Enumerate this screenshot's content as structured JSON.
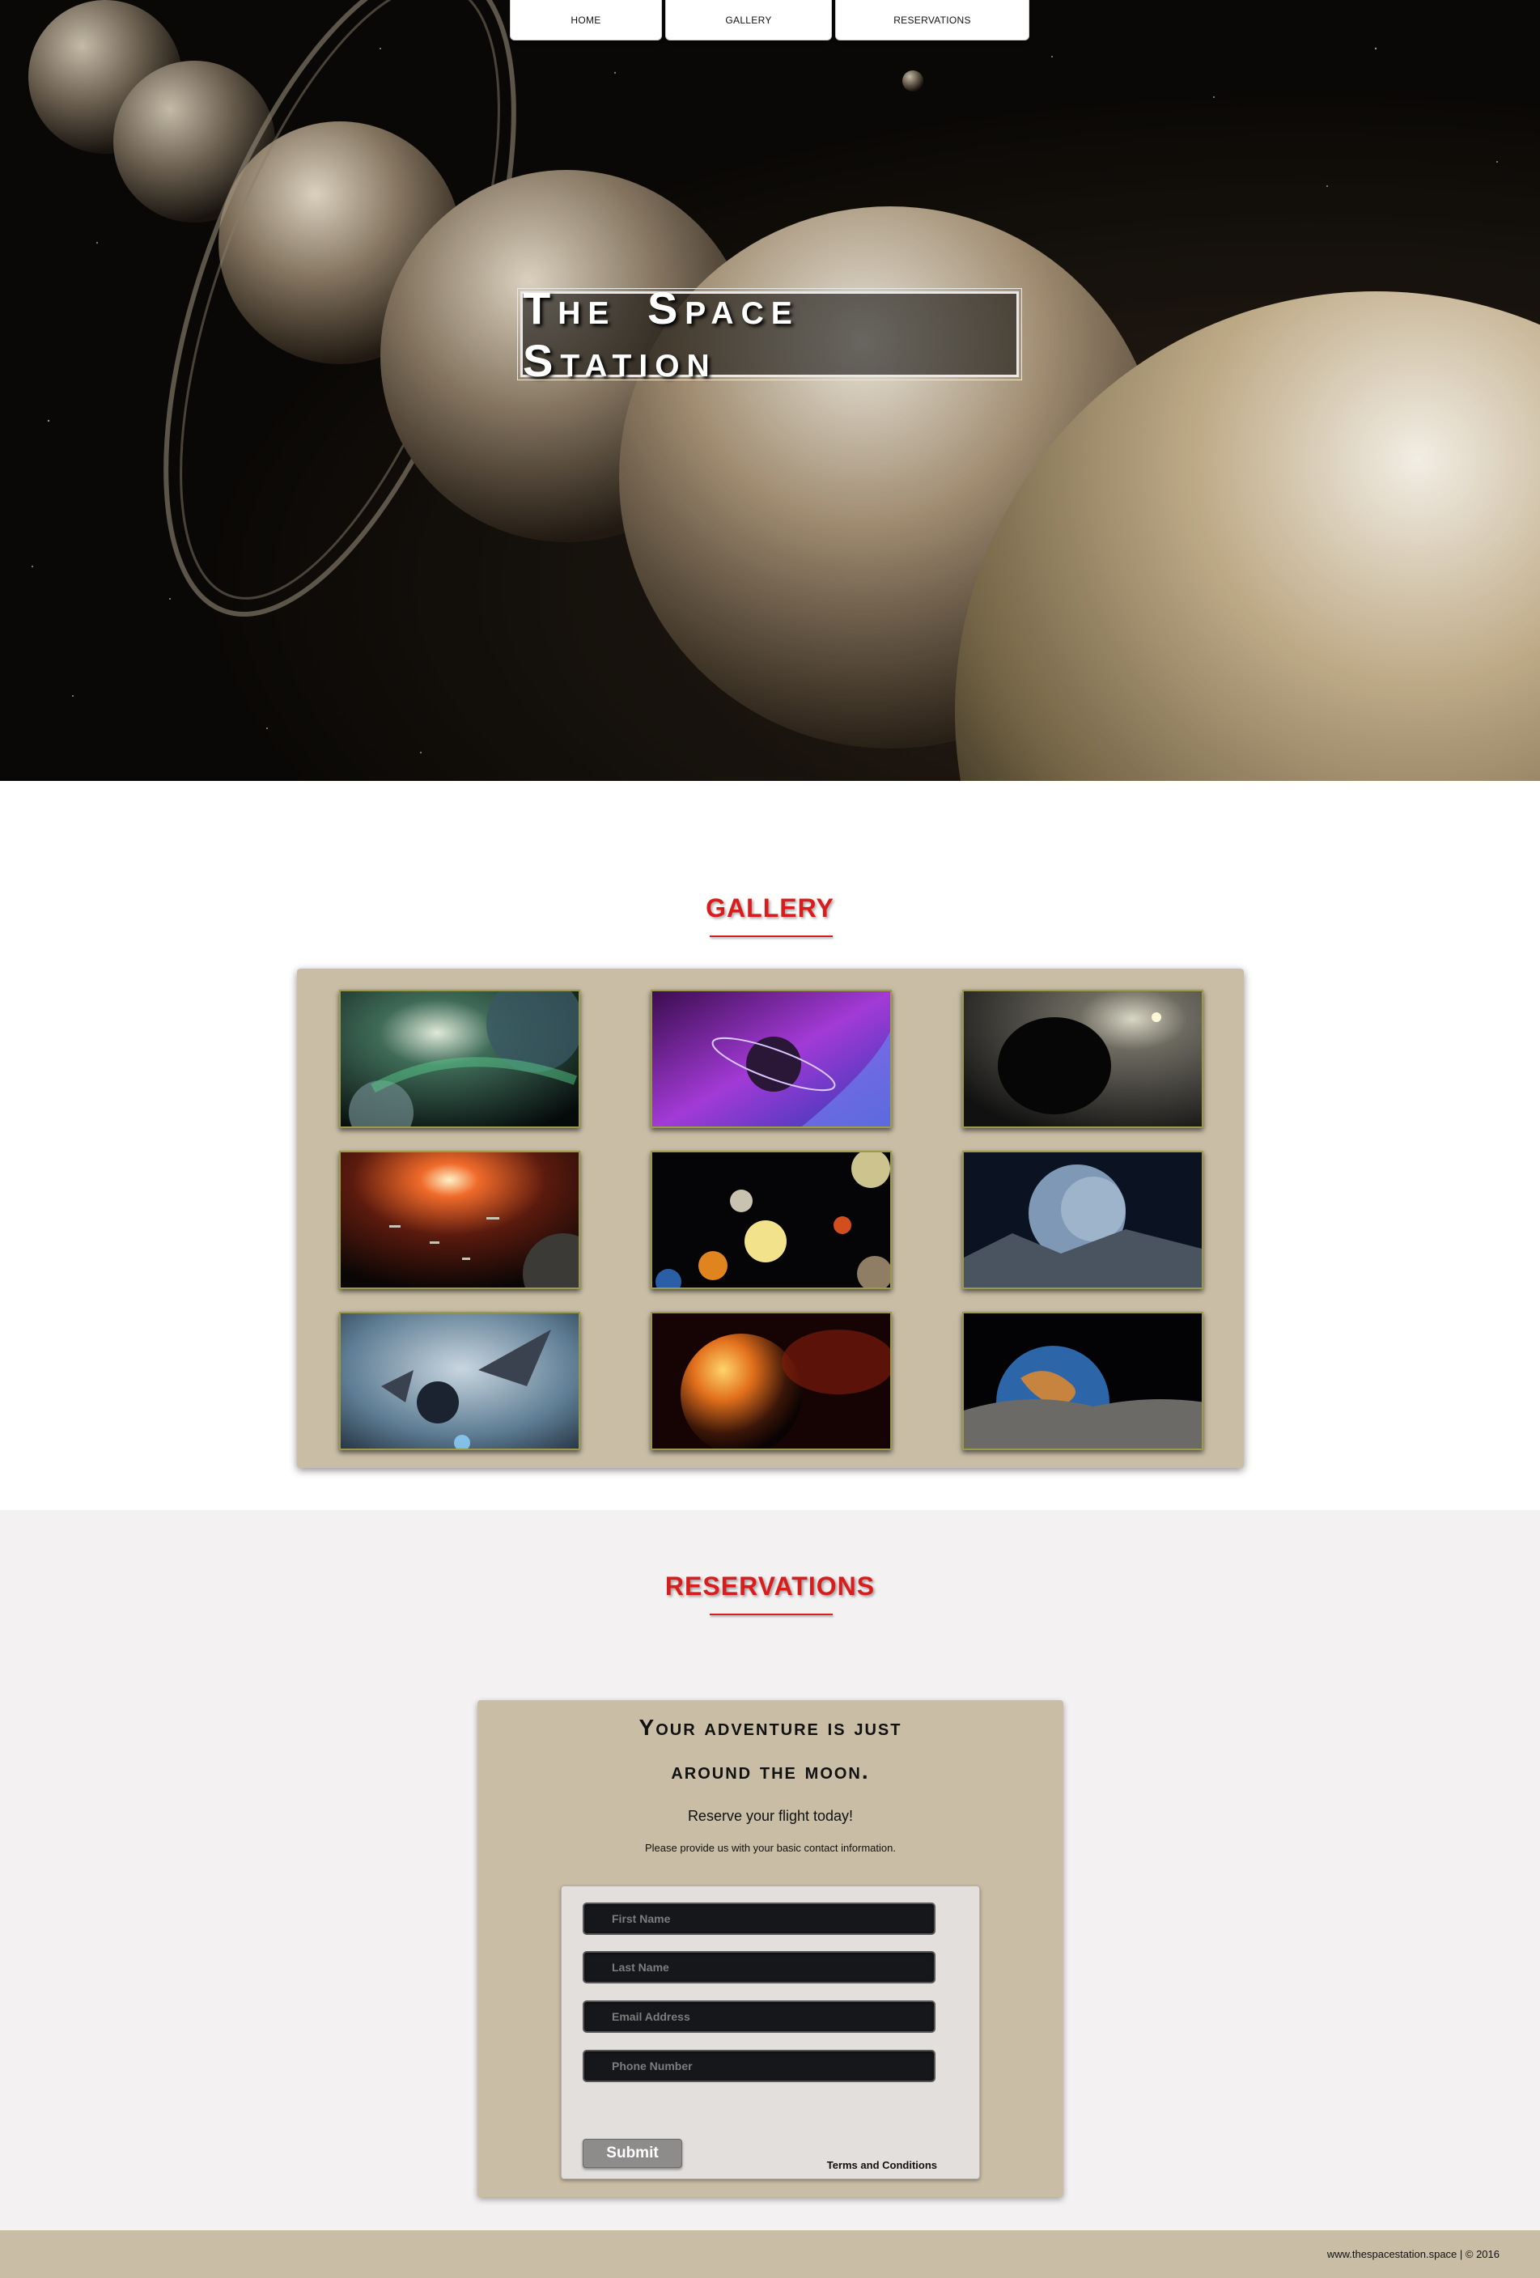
{
  "nav": {
    "items": [
      {
        "label": "HOME"
      },
      {
        "label": "GALLERY"
      },
      {
        "label": "RESERVATIONS"
      }
    ]
  },
  "hero": {
    "title": "The Space Station",
    "image_icon": "planets-image"
  },
  "gallery": {
    "title": "GALLERY",
    "thumbnails": [
      {
        "icon": "space-nebula-planet-image"
      },
      {
        "icon": "purple-ringed-planet-image"
      },
      {
        "icon": "black-hole-image"
      },
      {
        "icon": "space-battle-fleet-image"
      },
      {
        "icon": "solar-system-planets-image"
      },
      {
        "icon": "moon-surface-planet-image"
      },
      {
        "icon": "starships-blue-planet-image"
      },
      {
        "icon": "fiery-planet-image"
      },
      {
        "icon": "earth-from-moon-image"
      }
    ]
  },
  "reservations": {
    "title": "RESERVATIONS",
    "headline_line1": "Your adventure is just",
    "headline_line2": "around the moon.",
    "subhead": "Reserve your flight today!",
    "note": "Please provide us with your basic contact information.",
    "fields": [
      {
        "placeholder": "First Name"
      },
      {
        "placeholder": "Last Name"
      },
      {
        "placeholder": "Email Address"
      },
      {
        "placeholder": "Phone Number"
      }
    ],
    "submit_label": "Submit",
    "terms_label": "Terms and Conditions"
  },
  "footer": {
    "text": "www.thespacestation.space  |  © 2016"
  },
  "colors": {
    "accent_red": "#d91c1c",
    "panel_tan": "#c9bda6",
    "section_bg": "#f3f1f1",
    "field_dark": "#16171b"
  }
}
